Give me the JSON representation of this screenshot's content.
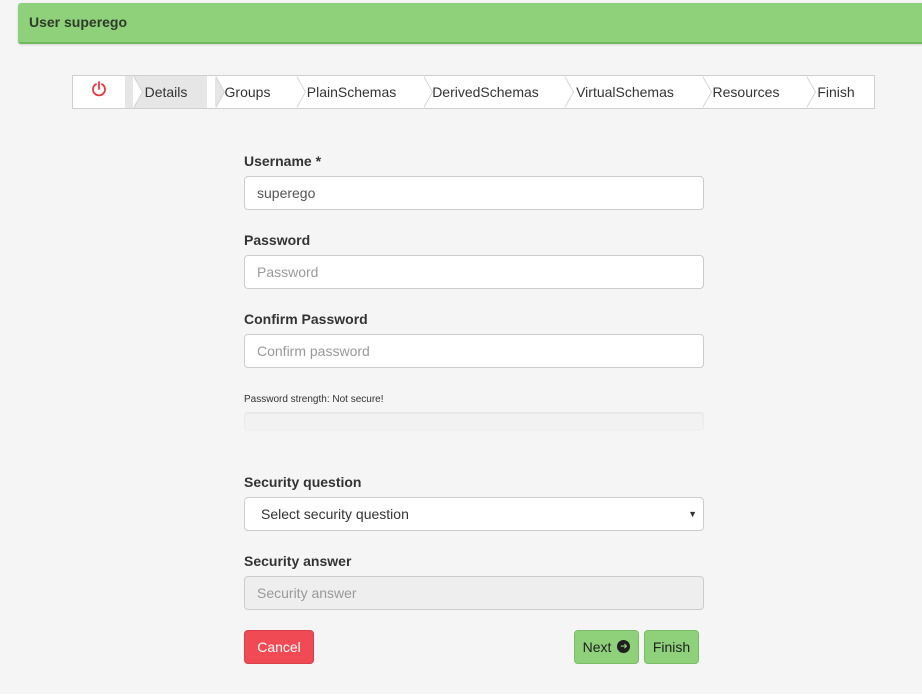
{
  "header": {
    "title": "User superego"
  },
  "wizard": {
    "steps": [
      {
        "label": ""
      },
      {
        "label": "Details"
      },
      {
        "label": "Groups"
      },
      {
        "label": "PlainSchemas"
      },
      {
        "label": "DerivedSchemas"
      },
      {
        "label": "VirtualSchemas"
      },
      {
        "label": "Resources"
      },
      {
        "label": "Finish"
      }
    ],
    "active_step": "Details"
  },
  "form": {
    "username": {
      "label": "Username *",
      "value": "superego"
    },
    "password": {
      "label": "Password",
      "placeholder": "Password",
      "value": ""
    },
    "confirm_password": {
      "label": "Confirm Password",
      "placeholder": "Confirm password",
      "value": ""
    },
    "strength_text": "Password strength: Not secure!",
    "security_question": {
      "label": "Security question",
      "selected": "Select security question"
    },
    "security_answer": {
      "label": "Security answer",
      "placeholder": "Security answer"
    }
  },
  "buttons": {
    "cancel": "Cancel",
    "next": "Next",
    "finish": "Finish"
  },
  "colors": {
    "accent_green": "#8fd17a",
    "danger_red": "#f04b55",
    "power_icon": "#e8383d"
  },
  "icons": {
    "power": "power-icon",
    "next_arrow": "arrow-circle-right-icon",
    "select_caret": "caret-down-icon"
  }
}
